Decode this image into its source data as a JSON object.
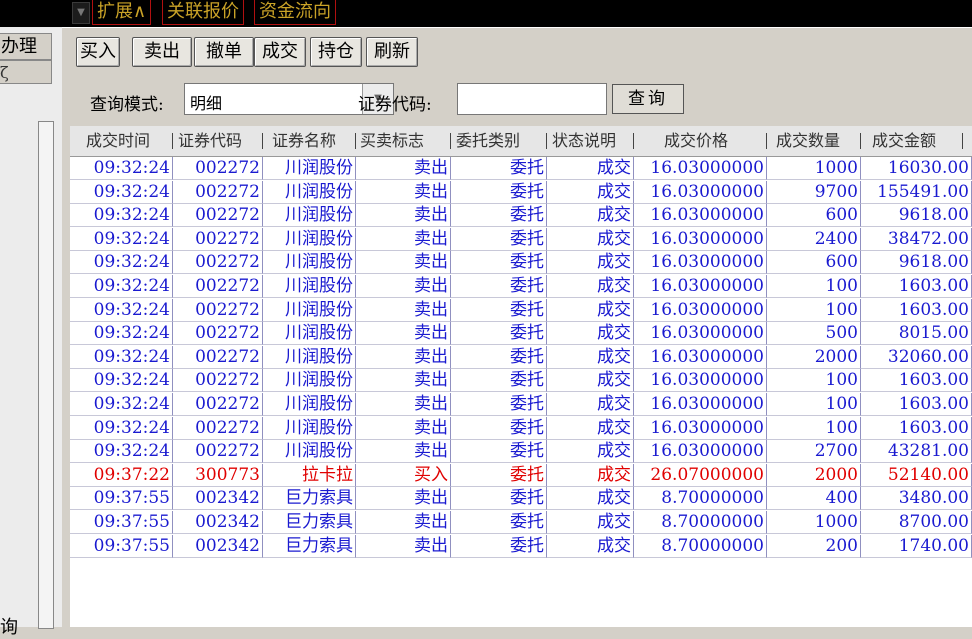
{
  "top_tabs": [
    "扩展∧",
    "关联报价",
    "资金流向"
  ],
  "left_panel": {
    "button_text": "办理",
    "second_text": "ζ",
    "bottom_text": "询"
  },
  "toolbar": {
    "buttons": [
      "买入",
      "卖出",
      "撤单",
      "成交",
      "持仓",
      "刷新"
    ]
  },
  "query": {
    "mode_label": "查询模式:",
    "mode_value": "明细",
    "code_label": "证券代码:",
    "code_value": "",
    "search_button": "查询"
  },
  "table": {
    "columns": [
      "成交时间",
      "证券代码",
      "证券名称",
      "买卖标志",
      "委托类别",
      "状态说明",
      "成交价格",
      "成交数量",
      "成交金额"
    ],
    "rows": [
      {
        "time": "09:32:24",
        "code": "002272",
        "name": "川润股份",
        "side": "卖出",
        "type": "委托",
        "status": "成交",
        "price": "16.03000000",
        "qty": "1000",
        "amount": "16030.00",
        "color": "#1a1ad0"
      },
      {
        "time": "09:32:24",
        "code": "002272",
        "name": "川润股份",
        "side": "卖出",
        "type": "委托",
        "status": "成交",
        "price": "16.03000000",
        "qty": "9700",
        "amount": "155491.00",
        "color": "#1a1ad0"
      },
      {
        "time": "09:32:24",
        "code": "002272",
        "name": "川润股份",
        "side": "卖出",
        "type": "委托",
        "status": "成交",
        "price": "16.03000000",
        "qty": "600",
        "amount": "9618.00",
        "color": "#1a1ad0"
      },
      {
        "time": "09:32:24",
        "code": "002272",
        "name": "川润股份",
        "side": "卖出",
        "type": "委托",
        "status": "成交",
        "price": "16.03000000",
        "qty": "2400",
        "amount": "38472.00",
        "color": "#1a1ad0"
      },
      {
        "time": "09:32:24",
        "code": "002272",
        "name": "川润股份",
        "side": "卖出",
        "type": "委托",
        "status": "成交",
        "price": "16.03000000",
        "qty": "600",
        "amount": "9618.00",
        "color": "#1a1ad0"
      },
      {
        "time": "09:32:24",
        "code": "002272",
        "name": "川润股份",
        "side": "卖出",
        "type": "委托",
        "status": "成交",
        "price": "16.03000000",
        "qty": "100",
        "amount": "1603.00",
        "color": "#1a1ad0"
      },
      {
        "time": "09:32:24",
        "code": "002272",
        "name": "川润股份",
        "side": "卖出",
        "type": "委托",
        "status": "成交",
        "price": "16.03000000",
        "qty": "100",
        "amount": "1603.00",
        "color": "#1a1ad0"
      },
      {
        "time": "09:32:24",
        "code": "002272",
        "name": "川润股份",
        "side": "卖出",
        "type": "委托",
        "status": "成交",
        "price": "16.03000000",
        "qty": "500",
        "amount": "8015.00",
        "color": "#1a1ad0"
      },
      {
        "time": "09:32:24",
        "code": "002272",
        "name": "川润股份",
        "side": "卖出",
        "type": "委托",
        "status": "成交",
        "price": "16.03000000",
        "qty": "2000",
        "amount": "32060.00",
        "color": "#1a1ad0"
      },
      {
        "time": "09:32:24",
        "code": "002272",
        "name": "川润股份",
        "side": "卖出",
        "type": "委托",
        "status": "成交",
        "price": "16.03000000",
        "qty": "100",
        "amount": "1603.00",
        "color": "#1a1ad0"
      },
      {
        "time": "09:32:24",
        "code": "002272",
        "name": "川润股份",
        "side": "卖出",
        "type": "委托",
        "status": "成交",
        "price": "16.03000000",
        "qty": "100",
        "amount": "1603.00",
        "color": "#1a1ad0"
      },
      {
        "time": "09:32:24",
        "code": "002272",
        "name": "川润股份",
        "side": "卖出",
        "type": "委托",
        "status": "成交",
        "price": "16.03000000",
        "qty": "100",
        "amount": "1603.00",
        "color": "#1a1ad0"
      },
      {
        "time": "09:32:24",
        "code": "002272",
        "name": "川润股份",
        "side": "卖出",
        "type": "委托",
        "status": "成交",
        "price": "16.03000000",
        "qty": "2700",
        "amount": "43281.00",
        "color": "#1a1ad0"
      },
      {
        "time": "09:37:22",
        "code": "300773",
        "name": "拉卡拉",
        "side": "买入",
        "type": "委托",
        "status": "成交",
        "price": "26.07000000",
        "qty": "2000",
        "amount": "52140.00",
        "color": "#e00000"
      },
      {
        "time": "09:37:55",
        "code": "002342",
        "name": "巨力索具",
        "side": "卖出",
        "type": "委托",
        "status": "成交",
        "price": "8.70000000",
        "qty": "400",
        "amount": "3480.00",
        "color": "#1a1ad0"
      },
      {
        "time": "09:37:55",
        "code": "002342",
        "name": "巨力索具",
        "side": "卖出",
        "type": "委托",
        "status": "成交",
        "price": "8.70000000",
        "qty": "1000",
        "amount": "8700.00",
        "color": "#1a1ad0"
      },
      {
        "time": "09:37:55",
        "code": "002342",
        "name": "巨力索具",
        "side": "卖出",
        "type": "委托",
        "status": "成交",
        "price": "8.70000000",
        "qty": "200",
        "amount": "1740.00",
        "color": "#1a1ad0"
      }
    ]
  }
}
